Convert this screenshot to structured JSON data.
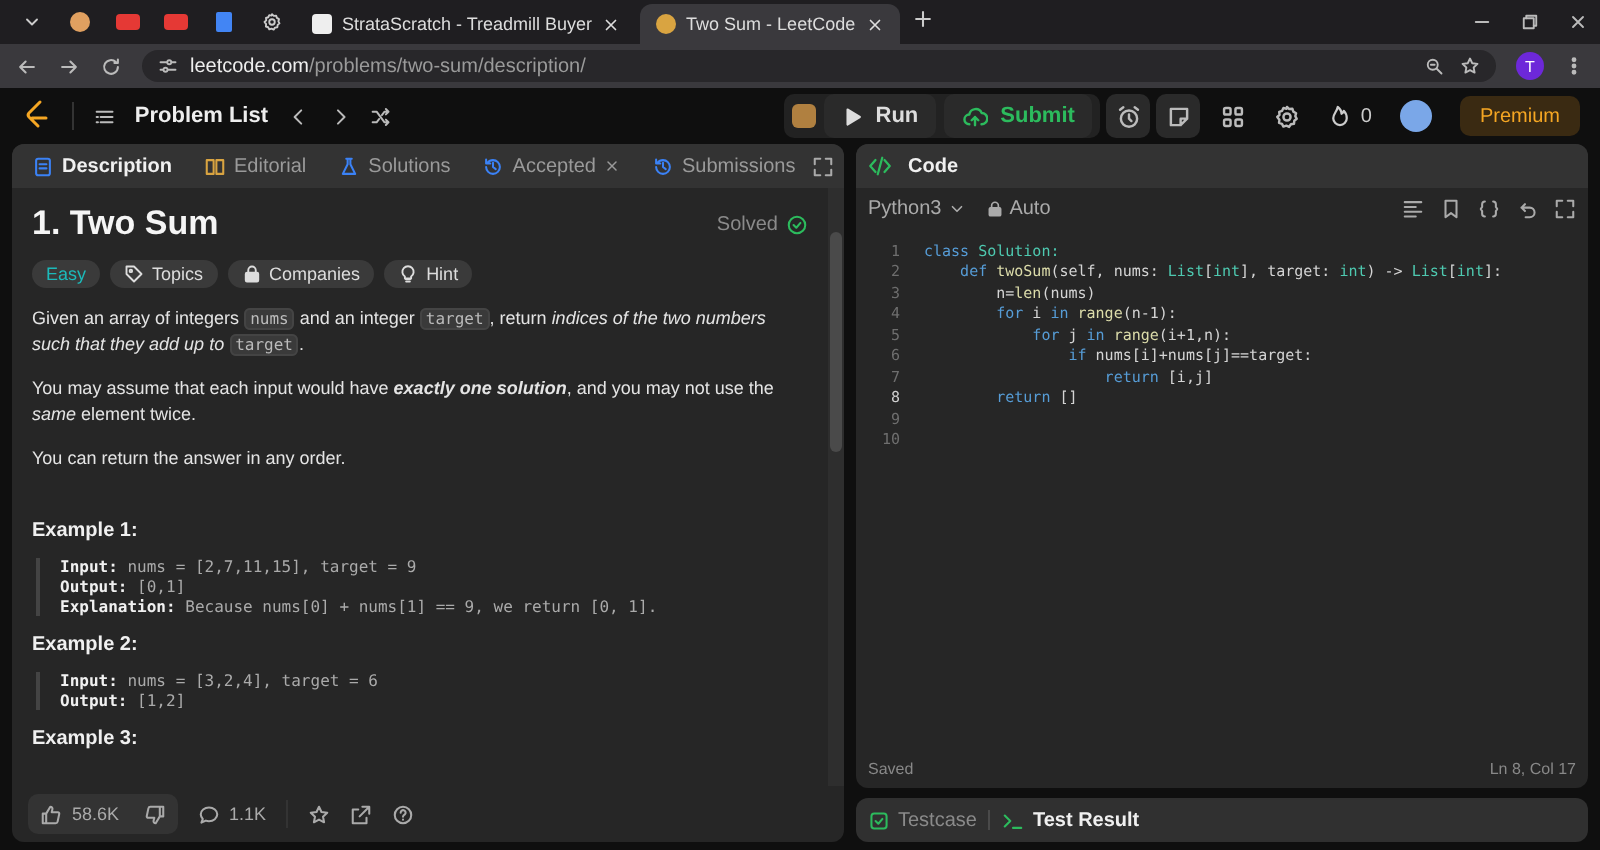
{
  "browser": {
    "tabs": [
      {
        "title": "StrataScratch - Treadmill Buyer",
        "selected": false
      },
      {
        "title": "Two Sum - LeetCode",
        "selected": true
      }
    ],
    "address": {
      "host": "leetcode.com",
      "path": "/problems/two-sum/description/"
    },
    "profile": "T"
  },
  "nav": {
    "problem_list": "Problem List",
    "run": "Run",
    "submit": "Submit",
    "streak": "0",
    "premium": "Premium"
  },
  "description_panel": {
    "tabs": [
      {
        "label": "Description",
        "selected": true,
        "closable": false
      },
      {
        "label": "Editorial",
        "selected": false,
        "closable": false
      },
      {
        "label": "Solutions",
        "selected": false,
        "closable": false
      },
      {
        "label": "Accepted",
        "selected": false,
        "closable": true
      },
      {
        "label": "Submissions",
        "selected": false,
        "closable": false
      }
    ],
    "title": "1. Two Sum",
    "status": "Solved",
    "tags": [
      {
        "label": "Easy",
        "kind": "difficulty"
      },
      {
        "label": "Topics",
        "kind": "topics"
      },
      {
        "label": "Companies",
        "kind": "companies"
      },
      {
        "label": "Hint",
        "kind": "hint"
      }
    ],
    "paragraphs": [
      [
        {
          "text": "Given an array of integers ",
          "kind": "plain"
        },
        {
          "text": "nums",
          "kind": "code"
        },
        {
          "text": " and an integer ",
          "kind": "plain"
        },
        {
          "text": "target",
          "kind": "code"
        },
        {
          "text": ", return ",
          "kind": "plain"
        },
        {
          "text": "indices of the two numbers such that they add up to ",
          "kind": "italic"
        },
        {
          "text": "target",
          "kind": "code"
        },
        {
          "text": ".",
          "kind": "plain"
        }
      ],
      [
        {
          "text": "You may assume that each input would have ",
          "kind": "plain"
        },
        {
          "text": "exactly one solution",
          "kind": "bold-italic"
        },
        {
          "text": ", and you may not use the ",
          "kind": "plain"
        },
        {
          "text": "same",
          "kind": "italic"
        },
        {
          "text": " element twice.",
          "kind": "plain"
        }
      ],
      [
        {
          "text": "You can return the answer in any order.",
          "kind": "plain"
        }
      ]
    ],
    "examples": [
      {
        "title": "Example 1:",
        "lines": [
          {
            "label": "Input:",
            "value": "nums = [2,7,11,15], target = 9"
          },
          {
            "label": "Output:",
            "value": "[0,1]"
          },
          {
            "label": "Explanation:",
            "value": "Because nums[0] + nums[1] == 9, we return [0, 1]."
          }
        ]
      },
      {
        "title": "Example 2:",
        "lines": [
          {
            "label": "Input:",
            "value": "nums = [3,2,4], target = 6"
          },
          {
            "label": "Output:",
            "value": "[1,2]"
          }
        ]
      },
      {
        "title": "Example 3:"
      }
    ],
    "likes": "58.6K",
    "comments": "1.1K"
  },
  "code_panel": {
    "title": "Code",
    "language": "Python3",
    "mode": "Auto",
    "lines": [
      {
        "number": "1",
        "current": false,
        "tokens": [
          {
            "t": "class",
            "kind": "kw"
          },
          {
            "t": " Solution:",
            "kind": "type"
          }
        ]
      },
      {
        "number": "2",
        "current": false,
        "tokens": [
          {
            "t": "    def ",
            "kind": "kw"
          },
          {
            "t": "twoSum",
            "kind": "fn"
          },
          {
            "t": "(self, nums: ",
            "kind": "plain"
          },
          {
            "t": "List",
            "kind": "type"
          },
          {
            "t": "[",
            "kind": "plain"
          },
          {
            "t": "int",
            "kind": "type"
          },
          {
            "t": "], target: ",
            "kind": "plain"
          },
          {
            "t": "int",
            "kind": "type"
          },
          {
            "t": ") -> ",
            "kind": "plain"
          },
          {
            "t": "List",
            "kind": "type"
          },
          {
            "t": "[",
            "kind": "plain"
          },
          {
            "t": "int",
            "kind": "type"
          },
          {
            "t": "]:",
            "kind": "plain"
          }
        ]
      },
      {
        "number": "3",
        "current": false,
        "tokens": [
          {
            "t": "        n=",
            "kind": "plain"
          },
          {
            "t": "len",
            "kind": "fn"
          },
          {
            "t": "(nums)",
            "kind": "plain"
          }
        ]
      },
      {
        "number": "4",
        "current": false,
        "tokens": [
          {
            "t": "        for",
            "kind": "kw"
          },
          {
            "t": " i ",
            "kind": "plain"
          },
          {
            "t": "in",
            "kind": "kw"
          },
          {
            "t": " range",
            "kind": "fn"
          },
          {
            "t": "(n-1):",
            "kind": "plain"
          }
        ]
      },
      {
        "number": "5",
        "current": false,
        "tokens": [
          {
            "t": "            for",
            "kind": "kw"
          },
          {
            "t": " j ",
            "kind": "plain"
          },
          {
            "t": "in",
            "kind": "kw"
          },
          {
            "t": " range",
            "kind": "fn"
          },
          {
            "t": "(i+1,n):",
            "kind": "plain"
          }
        ]
      },
      {
        "number": "6",
        "current": false,
        "tokens": [
          {
            "t": "                if",
            "kind": "kw"
          },
          {
            "t": " nums[i]+nums[j]==target:",
            "kind": "plain"
          }
        ]
      },
      {
        "number": "7",
        "current": false,
        "tokens": [
          {
            "t": "                    return",
            "kind": "kw"
          },
          {
            "t": " [i,j]",
            "kind": "plain"
          }
        ]
      },
      {
        "number": "8",
        "current": true,
        "tokens": [
          {
            "t": "        return",
            "kind": "kw"
          },
          {
            "t": " []",
            "kind": "plain"
          }
        ]
      },
      {
        "number": "9",
        "current": false
      },
      {
        "number": "10",
        "current": false
      }
    ],
    "status": "Saved",
    "cursor": "Ln 8, Col 17"
  },
  "bottom_panel": {
    "tabs": [
      {
        "label": "Testcase",
        "selected": false
      },
      {
        "label": "Test Result",
        "selected": true
      }
    ]
  }
}
